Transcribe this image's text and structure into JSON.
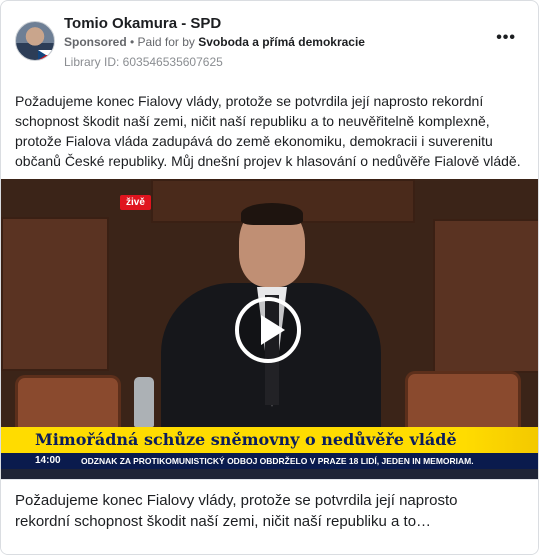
{
  "post": {
    "page_name": "Tomio Okamura - SPD",
    "sponsored_label": "Sponsored",
    "separator": " • ",
    "paid_for_prefix": "Paid for by ",
    "payer": "Svoboda a přímá demokracie",
    "library_id": "Library ID: 603546535607625",
    "more_icon": "•••",
    "body_text": "Požadujeme konec Fialovy vlády, protože se potvrdila její naprosto rekordní schopnost škodit naší zemi, ničit naší republiku a to neuvěřitelně komplexně, protože Fialova vláda zadupává do země ekonomiku, demokracii i suverenitu občanů České republiky. Můj dnešní projev k hlasování o nedůvěře Fialově vládě."
  },
  "video": {
    "live_badge": "živě",
    "headline": "Mimořádná schůze sněmovny o nedůvěře vládě",
    "ticker_time": "14:00",
    "ticker_text": "ODZNAK ZA PROTIKOMUNISTICKÝ ODBOJ OBDRŽELO V PRAZE 18 LIDÍ, JEDEN IN MEMORIAM.",
    "play_icon": "play-icon"
  },
  "caption": {
    "text": "Požadujeme konec Fialovy vlády, protože se potvrdila její naprosto rekordní schopnost škodit naší zemi, ničit naší republiku a to…"
  },
  "colors": {
    "headline_bar": "#ffdc00",
    "headline_text": "#0b1d5c",
    "ticker_bg": "#0a1b4d",
    "live_badge": "#e0141e"
  }
}
